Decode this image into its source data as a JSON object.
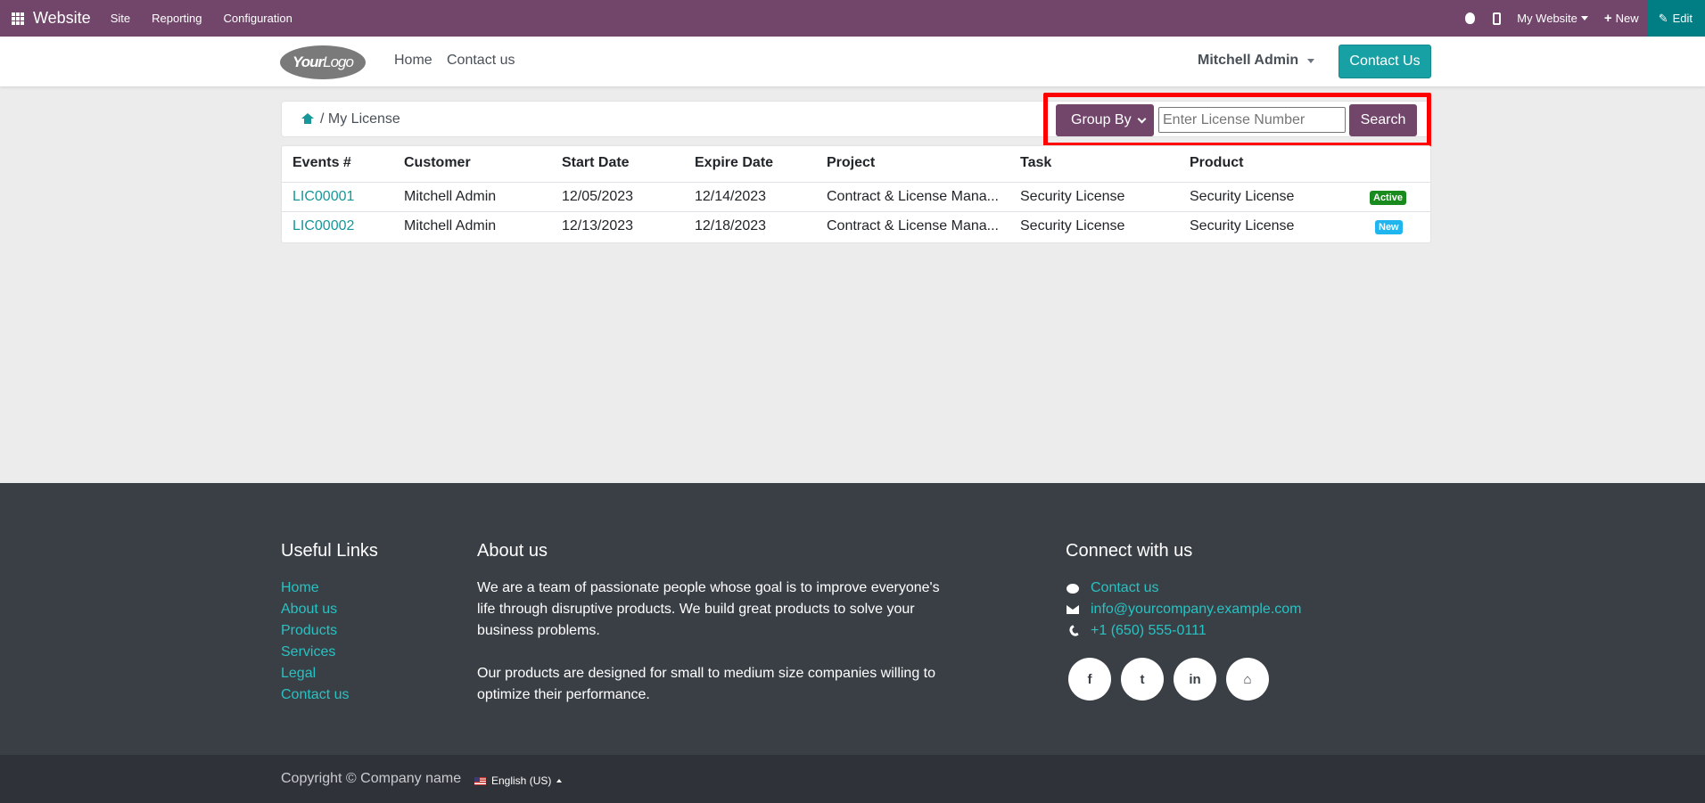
{
  "topbar": {
    "brand": "Website",
    "menu": [
      "Site",
      "Reporting",
      "Configuration"
    ],
    "website_selector": "My Website",
    "new_label": "New",
    "edit_label": "Edit",
    "bg_color": "#71466a"
  },
  "header": {
    "logo_main": "Your",
    "logo_light": "Logo",
    "nav": [
      "Home",
      "Contact us"
    ],
    "user": "Mitchell Admin",
    "contact_button": "Contact Us"
  },
  "breadcrumb": {
    "text": "/ My License"
  },
  "search": {
    "group_by": "Group By",
    "placeholder": "Enter License Number",
    "button": "Search"
  },
  "table": {
    "columns": [
      "Events #",
      "Customer",
      "Start Date",
      "Expire Date",
      "Project",
      "Task",
      "Product"
    ],
    "rows": [
      {
        "id": "LIC00001",
        "customer": "Mitchell Admin",
        "start": "12/05/2023",
        "expire": "12/14/2023",
        "project": "Contract & License Mana...",
        "task": "Security License",
        "product": "Security License",
        "status": "Active",
        "status_color": "#198a1d"
      },
      {
        "id": "LIC00002",
        "customer": "Mitchell Admin",
        "start": "12/13/2023",
        "expire": "12/18/2023",
        "project": "Contract & License Mana...",
        "task": "Security License",
        "product": "Security License",
        "status": "New",
        "status_color": "#1fb5ee"
      }
    ]
  },
  "footer": {
    "useful_links_title": "Useful Links",
    "useful_links": [
      "Home",
      "About us",
      "Products",
      "Services",
      "Legal",
      "Contact us"
    ],
    "about_title": "About us",
    "about_p1": "We are a team of passionate people whose goal is to improve everyone's life through disruptive products. We build great products to solve your business problems.",
    "about_p2": "Our products are designed for small to medium size companies willing to optimize their performance.",
    "connect_title": "Connect with us",
    "contact_link": "Contact us",
    "email": "info@yourcompany.example.com",
    "phone": "+1 (650) 555-0111",
    "social_icons": [
      "facebook-icon",
      "twitter-icon",
      "linkedin-icon",
      "home-icon"
    ],
    "social_glyphs": [
      "f",
      "t",
      "in",
      "⌂"
    ]
  },
  "bottom": {
    "copyright": "Copyright © Company name",
    "language": "English (US)"
  }
}
